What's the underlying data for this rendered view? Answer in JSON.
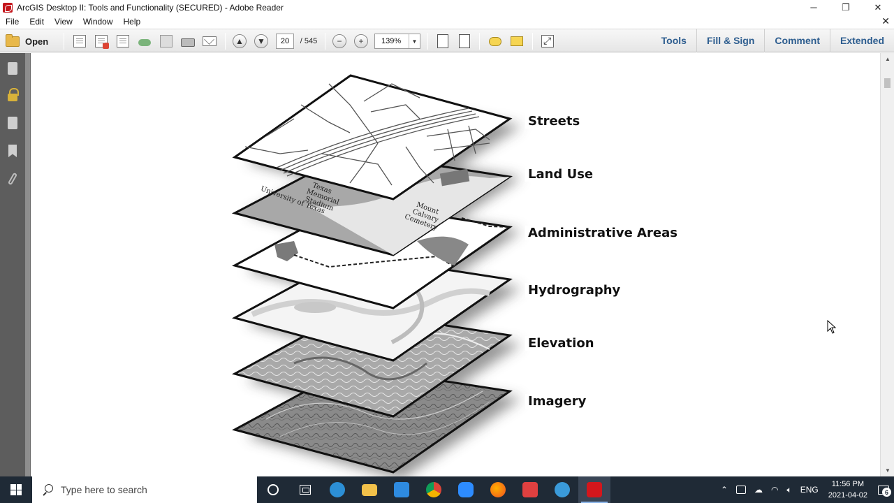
{
  "window": {
    "title": "ArcGIS Desktop II: Tools and Functionality (SECURED) - Adobe Reader",
    "minimize_glyph": "─",
    "restore_glyph": "❐",
    "close_glyph": "✕"
  },
  "menubar": {
    "items": [
      "File",
      "Edit",
      "View",
      "Window",
      "Help"
    ],
    "close_glyph": "✕"
  },
  "toolbar": {
    "open_label": "Open",
    "page_current": "20",
    "page_total": "/ 545",
    "zoom": "139%",
    "right_items": [
      "Tools",
      "Fill & Sign",
      "Comment",
      "Extended"
    ]
  },
  "document": {
    "layers": [
      "Streets",
      "Land Use",
      "Administrative Areas",
      "Hydrography",
      "Elevation",
      "Imagery"
    ],
    "landuse_text": [
      "Texas",
      "Memorial",
      "Stadium",
      "University of Texas",
      "Mount",
      "Calvary",
      "Cemetery"
    ]
  },
  "taskbar": {
    "search_placeholder": "Type here to search",
    "apps": [
      {
        "name": "edge",
        "color": "#2c8fd6"
      },
      {
        "name": "file-explorer",
        "color": "#f2c14a"
      },
      {
        "name": "store",
        "color": "#2e8be0"
      },
      {
        "name": "chrome",
        "color": "#e8b42b"
      },
      {
        "name": "zoom",
        "color": "#2d8cff"
      },
      {
        "name": "firefox",
        "color": "#f07020"
      },
      {
        "name": "app-red",
        "color": "#e04040"
      },
      {
        "name": "app-search",
        "color": "#3a9ad9"
      },
      {
        "name": "adobe-reader",
        "color": "#d4161c"
      }
    ],
    "language": "ENG",
    "time": "11:56 PM",
    "date": "2021-04-02",
    "notification_count": "6"
  }
}
